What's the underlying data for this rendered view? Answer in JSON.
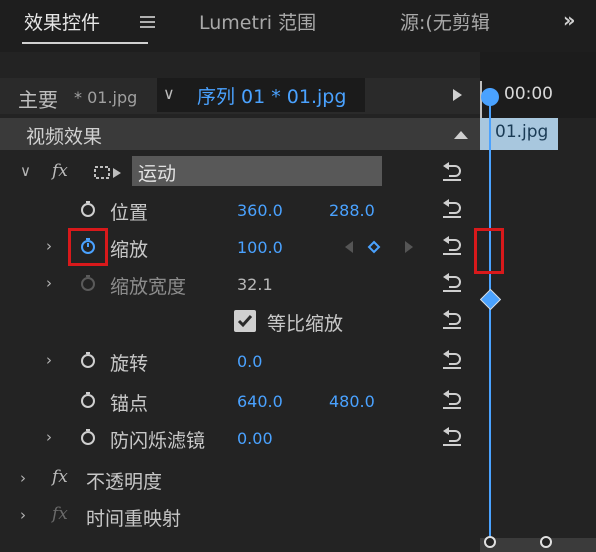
{
  "tabs": [
    {
      "label": "效果控件",
      "active": true
    },
    {
      "label": "Lumetri 范围",
      "active": false
    },
    {
      "label": "源:(无剪辑",
      "active": false
    }
  ],
  "icons": {
    "tab_menu": "hamburger-icon",
    "tab_overflow": "chevron-double-right-icon",
    "stopwatch": "stopwatch-icon",
    "reset": "reset-icon",
    "motion": "transform-box-icon"
  },
  "colors": {
    "accent": "#4aa2ff",
    "highlight": "#d8191b",
    "clip": "#a8c7de"
  },
  "header": {
    "master_label": "主要",
    "master_clip": "* 01.jpg",
    "sequence": "序列 01 * 01.jpg",
    "video_effects": "视频效果"
  },
  "effects": {
    "motion": {
      "fx": "fx",
      "name": "运动",
      "position": {
        "label": "位置",
        "x": "360.0",
        "y": "288.0"
      },
      "scale": {
        "label": "缩放",
        "value": "100.0"
      },
      "scale_width": {
        "label": "缩放宽度",
        "value": "32.1"
      },
      "uniform_scale": {
        "label": "等比缩放",
        "checked": true
      },
      "rotation": {
        "label": "旋转",
        "value": "0.0"
      },
      "anchor": {
        "label": "锚点",
        "x": "640.0",
        "y": "480.0"
      },
      "antiflicker": {
        "label": "防闪烁滤镜",
        "value": "0.00"
      }
    },
    "opacity": {
      "fx": "fx",
      "name": "不透明度"
    },
    "time_remap": {
      "fx": "fx",
      "name": "时间重映射"
    }
  },
  "timeline": {
    "time": "00:00",
    "clip": "01.jpg"
  }
}
